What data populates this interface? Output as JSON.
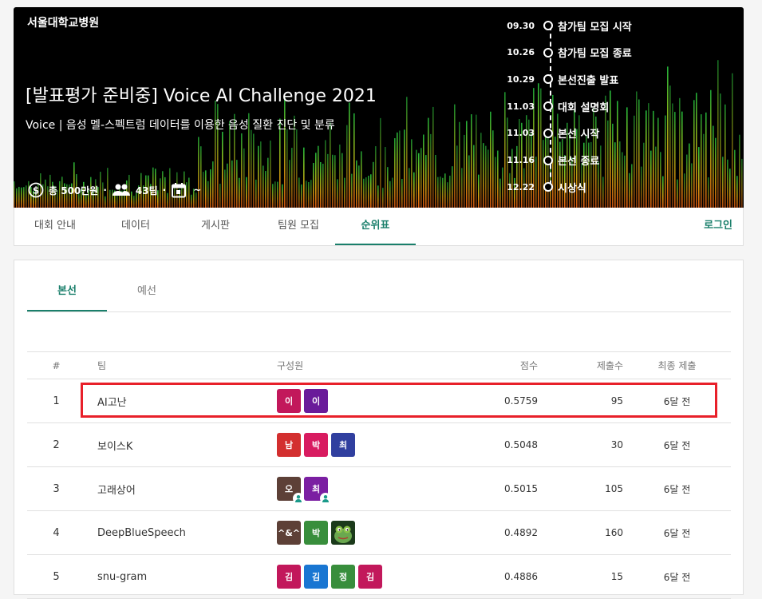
{
  "banner": {
    "org": "서울대학교병원",
    "title": "[발표평가 준비중] Voice AI Challenge 2021",
    "subtitle": "Voice | 음성 멜-스펙트럼 데이터를 이용한 음성 질환 진단 및 분류",
    "prize": "총 500만원",
    "teams": "43팀",
    "dot1": "·",
    "dot2": "·",
    "period": "~",
    "timeline": [
      {
        "date": "09.30",
        "label": "참가팀 모집 시작"
      },
      {
        "date": "10.26",
        "label": "참가팀 모집 종료"
      },
      {
        "date": "10.29",
        "label": "본선진출 발표"
      },
      {
        "date": "11.03",
        "label": "대회 설명회"
      },
      {
        "date": "11.03",
        "label": "본선 시작"
      },
      {
        "date": "11.16",
        "label": "본선 종료"
      },
      {
        "date": "12.22",
        "label": "시상식"
      }
    ]
  },
  "nav": {
    "tabs": [
      "대회 안내",
      "데이터",
      "게시판",
      "팀원 모집",
      "순위표"
    ],
    "active_tab": "순위표",
    "login": "로그인"
  },
  "leaderboard": {
    "subtabs": [
      "본선",
      "예선"
    ],
    "active_subtab": "본선",
    "headers": {
      "rank": "#",
      "team": "팀",
      "members": "구성원",
      "score": "점수",
      "submissions": "제출수",
      "last": "최종 제출"
    },
    "rows": [
      {
        "rank": "1",
        "team": "AI고난",
        "members": [
          {
            "t": "이",
            "c": "#c2185b"
          },
          {
            "t": "이",
            "c": "#6a1b9a"
          }
        ],
        "score": "0.5759",
        "submissions": "95",
        "last": "6달 전"
      },
      {
        "rank": "2",
        "team": "보이스K",
        "members": [
          {
            "t": "남",
            "c": "#d32f2f"
          },
          {
            "t": "박",
            "c": "#d81b60"
          },
          {
            "t": "최",
            "c": "#303f9f"
          }
        ],
        "score": "0.5048",
        "submissions": "30",
        "last": "6달 전"
      },
      {
        "rank": "3",
        "team": "고래상어",
        "members": [
          {
            "t": "오",
            "c": "#5d4037",
            "badge": true
          },
          {
            "t": "최",
            "c": "#7b1fa2",
            "badge": true
          }
        ],
        "score": "0.5015",
        "submissions": "105",
        "last": "6달 전"
      },
      {
        "rank": "4",
        "team": "DeepBlueSpeech",
        "members": [
          {
            "t": "^&^",
            "c": "#5d4037"
          },
          {
            "t": "박",
            "c": "#388e3c"
          },
          {
            "t": "",
            "c": "#1b3a1b",
            "img": "frog-avatar"
          }
        ],
        "score": "0.4892",
        "submissions": "160",
        "last": "6달 전"
      },
      {
        "rank": "5",
        "team": "snu-gram",
        "members": [
          {
            "t": "김",
            "c": "#c2185b"
          },
          {
            "t": "김",
            "c": "#1976d2"
          },
          {
            "t": "정",
            "c": "#388e3c"
          },
          {
            "t": "김",
            "c": "#c2185b"
          }
        ],
        "score": "0.4886",
        "submissions": "15",
        "last": "6달 전"
      }
    ],
    "highlight_color": "#e8202a",
    "accent_color": "#1a7f6b"
  }
}
